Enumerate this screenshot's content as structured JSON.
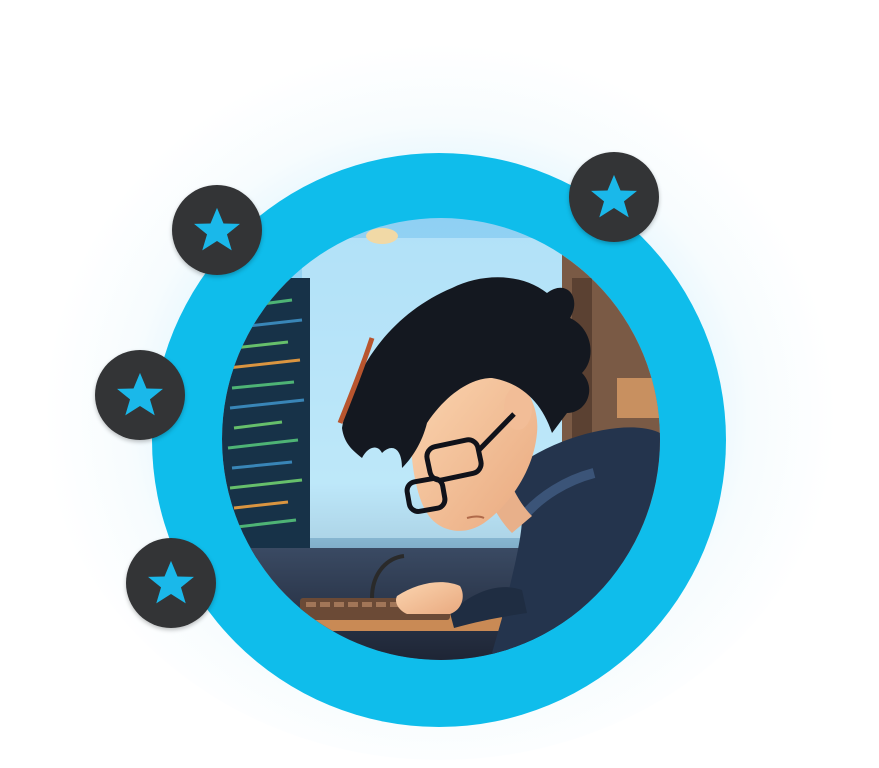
{
  "profile": {
    "illustration": "anime-programmer-typing-at-keyboard",
    "ring_color": "#0fbdeb",
    "glow_color": "#58c4f0"
  },
  "badges": [
    {
      "icon": "star-icon",
      "color": "#1ab8ea",
      "background": "#333436"
    },
    {
      "icon": "star-icon",
      "color": "#1ab8ea",
      "background": "#333436"
    },
    {
      "icon": "star-icon",
      "color": "#1ab8ea",
      "background": "#333436"
    },
    {
      "icon": "star-icon",
      "color": "#1ab8ea",
      "background": "#333436"
    }
  ]
}
